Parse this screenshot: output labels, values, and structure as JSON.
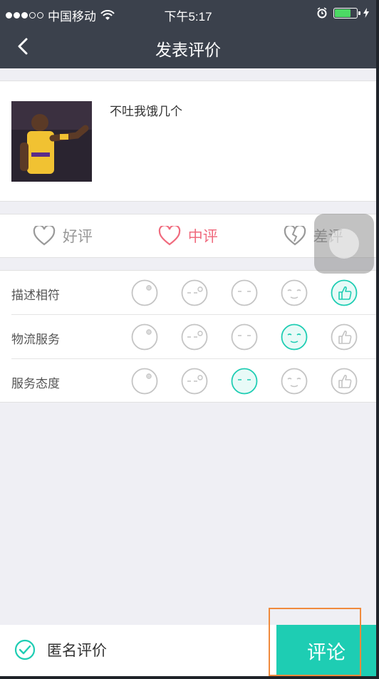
{
  "status_bar": {
    "carrier": "中国移动",
    "time": "下午5:17"
  },
  "nav": {
    "title": "发表评价"
  },
  "product": {
    "name": "不吐我饿几个"
  },
  "rating": {
    "options": [
      {
        "label": "好评"
      },
      {
        "label": "中评"
      },
      {
        "label": "差评"
      }
    ],
    "selected": "中评"
  },
  "detail_ratings": [
    {
      "label": "描述相符",
      "selected": 5
    },
    {
      "label": "物流服务",
      "selected": 4
    },
    {
      "label": "服务态度",
      "selected": 3
    }
  ],
  "face_icons": [
    "very-unhappy-face-icon",
    "unhappy-face-icon",
    "neutral-face-icon",
    "happy-face-icon",
    "thumbs-up-icon"
  ],
  "bottom": {
    "anonymous_label": "匿名评价",
    "submit_label": "评论"
  },
  "colors": {
    "accent": "#1ecdb3",
    "active_rating": "#f06b7e",
    "bar": "#3b414c",
    "highlight": "#f08a3c"
  }
}
